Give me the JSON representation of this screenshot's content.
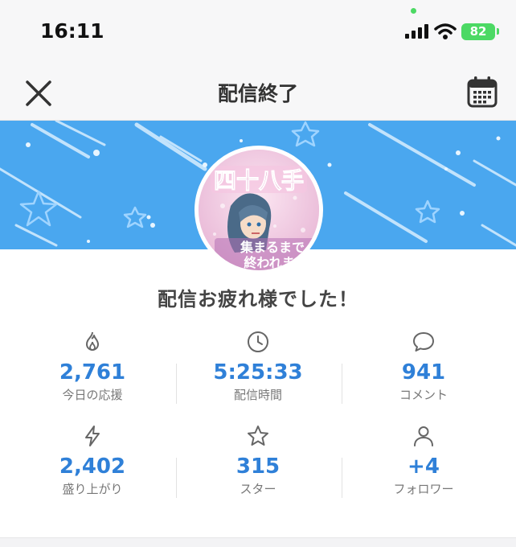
{
  "status_bar": {
    "time": "16:11",
    "battery": "82"
  },
  "nav": {
    "title": "配信終了"
  },
  "avatar": {
    "text_top": "四十八手",
    "text_bottom_1": "集まるまで",
    "text_bottom_2": "終われま"
  },
  "headline": "配信お疲れ様でした！",
  "stats": [
    {
      "icon": "flame-icon",
      "value": "2,761",
      "label": "今日の応援"
    },
    {
      "icon": "clock-icon",
      "value": "5:25:33",
      "label": "配信時間"
    },
    {
      "icon": "comment-icon",
      "value": "941",
      "label": "コメント"
    },
    {
      "icon": "lightning-icon",
      "value": "2,402",
      "label": "盛り上がり"
    },
    {
      "icon": "star-icon",
      "value": "315",
      "label": "スター"
    },
    {
      "icon": "person-icon",
      "value": "+4",
      "label": "フォロワー"
    }
  ],
  "colors": {
    "accent": "#2f80d8",
    "banner": "#4aa7ef",
    "battery": "#4cd964"
  }
}
